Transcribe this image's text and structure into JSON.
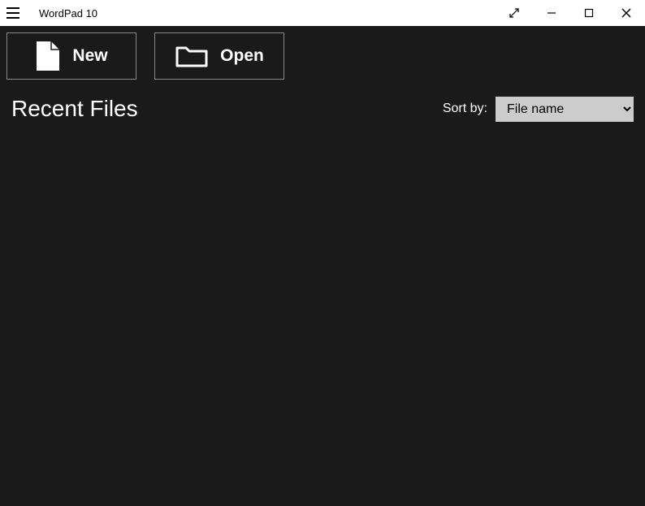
{
  "titlebar": {
    "app_title": "WordPad 10"
  },
  "toolbar": {
    "new_label": "New",
    "open_label": "Open"
  },
  "recent": {
    "heading": "Recent Files",
    "sort_label": "Sort by:",
    "sort_selected": "File name",
    "sort_options": [
      "File name"
    ]
  }
}
